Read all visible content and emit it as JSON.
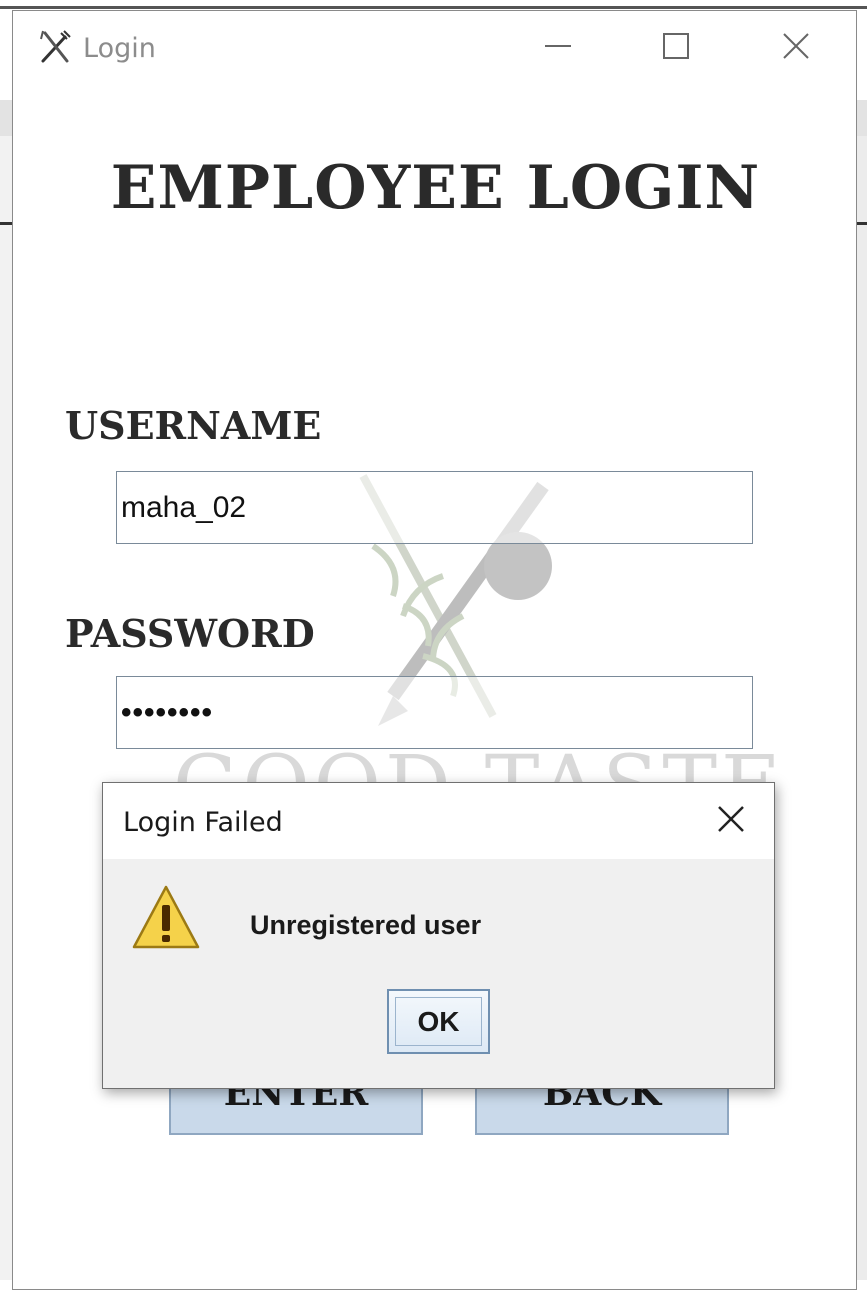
{
  "window": {
    "title": "Login",
    "controls": [
      "minimize-icon",
      "maximize-icon",
      "close-icon"
    ]
  },
  "form": {
    "heading": "EMPLOYEE LOGIN",
    "username_label": "USERNAME",
    "username_value": "maha_02",
    "password_label": "PASSWORD",
    "password_value": "••••••••",
    "enter_label": "ENTER",
    "back_label": "BACK"
  },
  "watermark": {
    "text": "GOOD TASTE"
  },
  "dialog": {
    "title": "Login Failed",
    "message": "Unregistered user",
    "ok_label": "OK",
    "icon": "warning-icon"
  },
  "colors": {
    "button_fill": "#c9d9ea",
    "warning_yellow": "#f5d24a",
    "heading_text": "#2a2a2a"
  }
}
